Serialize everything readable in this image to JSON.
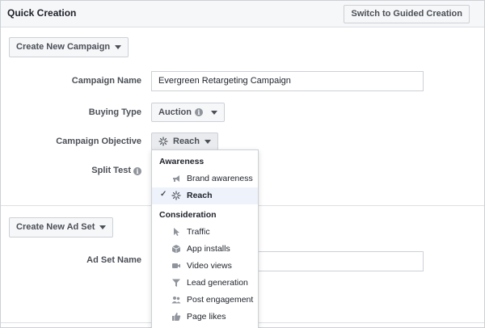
{
  "header": {
    "title": "Quick Creation",
    "guided_button": "Switch to Guided Creation"
  },
  "campaign": {
    "create_button": "Create New Campaign",
    "name_label": "Campaign Name",
    "name_value": "Evergreen Retargeting Campaign",
    "buying_type_label": "Buying Type",
    "buying_type_value": "Auction",
    "objective_label": "Campaign Objective",
    "objective_value": "Reach",
    "split_test_label": "Split Test"
  },
  "ad_set": {
    "create_button": "Create New Ad Set",
    "name_label": "Ad Set Name",
    "name_value": ""
  },
  "objective_menu": {
    "groups": [
      {
        "title": "Awareness",
        "items": [
          {
            "label": "Brand awareness",
            "icon": "megaphone-icon",
            "selected": false
          },
          {
            "label": "Reach",
            "icon": "reach-icon",
            "selected": true
          }
        ]
      },
      {
        "title": "Consideration",
        "items": [
          {
            "label": "Traffic",
            "icon": "cursor-icon",
            "selected": false
          },
          {
            "label": "App installs",
            "icon": "box-icon",
            "selected": false
          },
          {
            "label": "Video views",
            "icon": "video-camera-icon",
            "selected": false
          },
          {
            "label": "Lead generation",
            "icon": "funnel-icon",
            "selected": false
          },
          {
            "label": "Post engagement",
            "icon": "people-icon",
            "selected": false
          },
          {
            "label": "Page likes",
            "icon": "thumbs-up-icon",
            "selected": false
          }
        ]
      }
    ]
  },
  "colors": {
    "border": "#ccd0d5",
    "text": "#1d2129",
    "muted": "#4b4f56",
    "selected_bg": "#eef3fb",
    "icon": "#90949c"
  }
}
